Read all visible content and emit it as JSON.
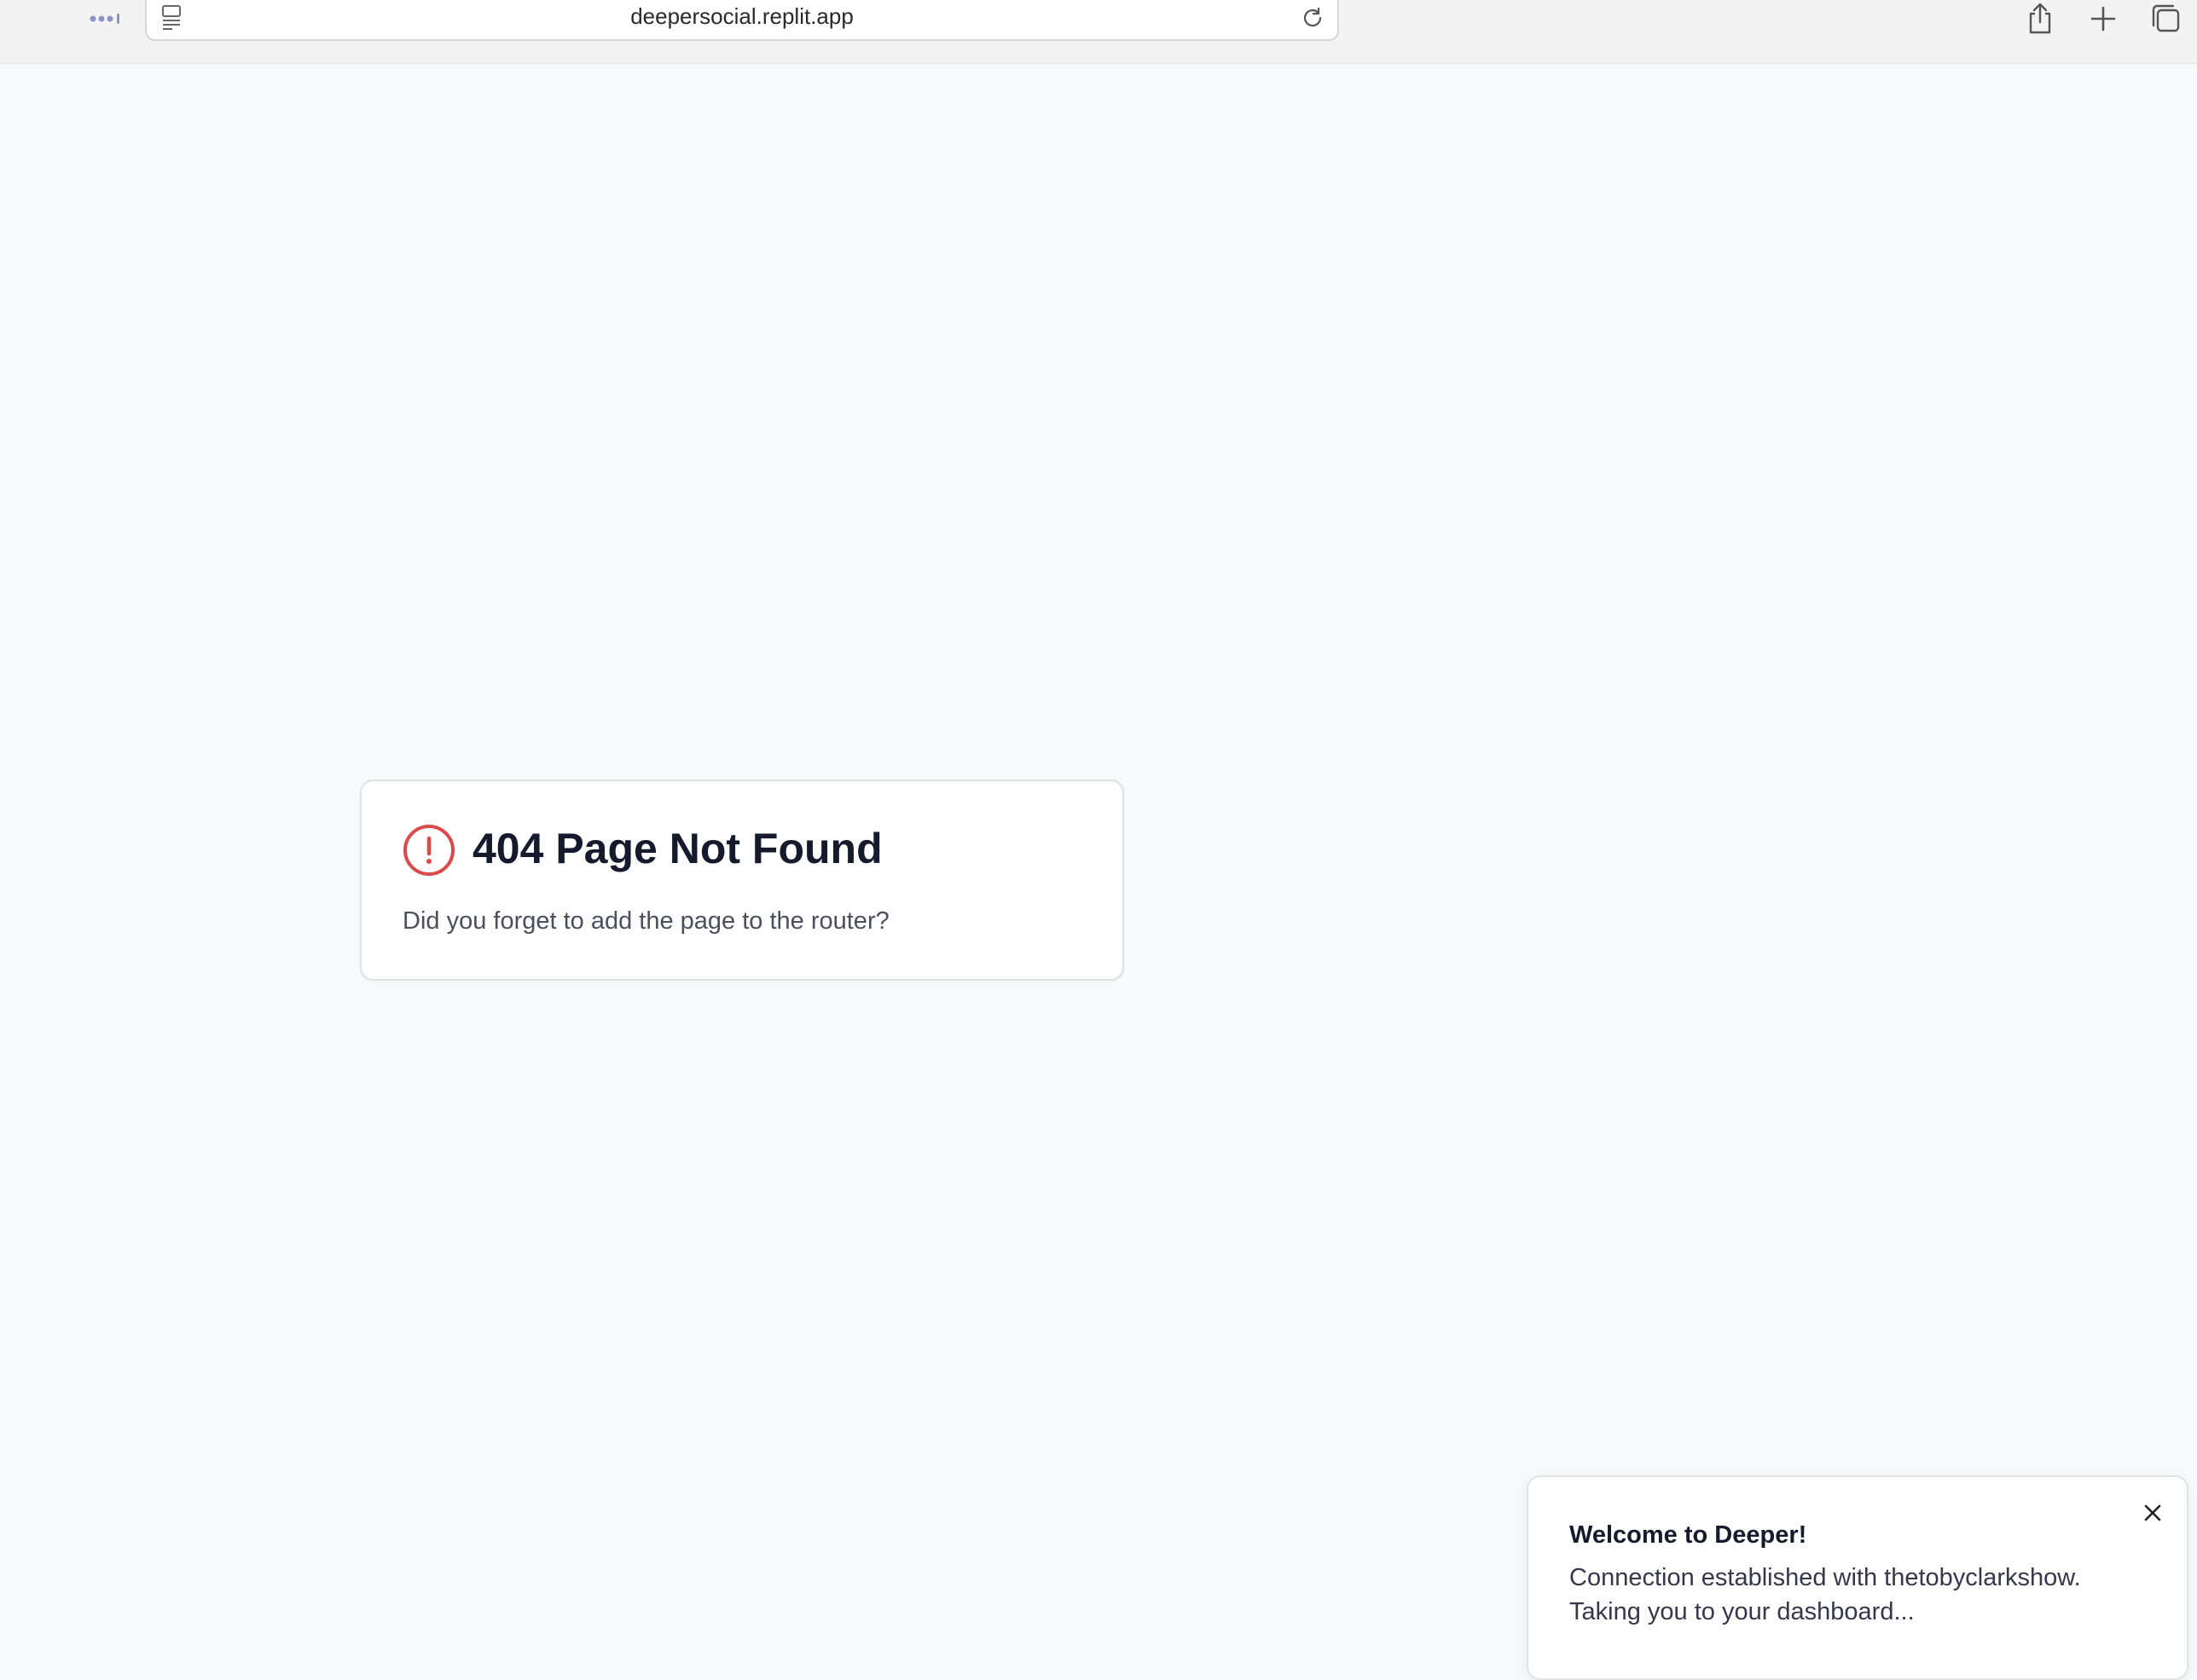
{
  "browser": {
    "url": "deepersocial.replit.app"
  },
  "error_card": {
    "title": "404 Page Not Found",
    "message": "Did you forget to add the page to the router?",
    "icon": "alert-circle-icon",
    "icon_color": "#dc4a4a"
  },
  "toast": {
    "title": "Welcome to Deeper!",
    "line1": "Connection established with thetobyclarkshow.",
    "line2": "Taking you to your dashboard..."
  },
  "colors": {
    "page_background": "#f8f9fb",
    "title_text": "#151a2c"
  }
}
